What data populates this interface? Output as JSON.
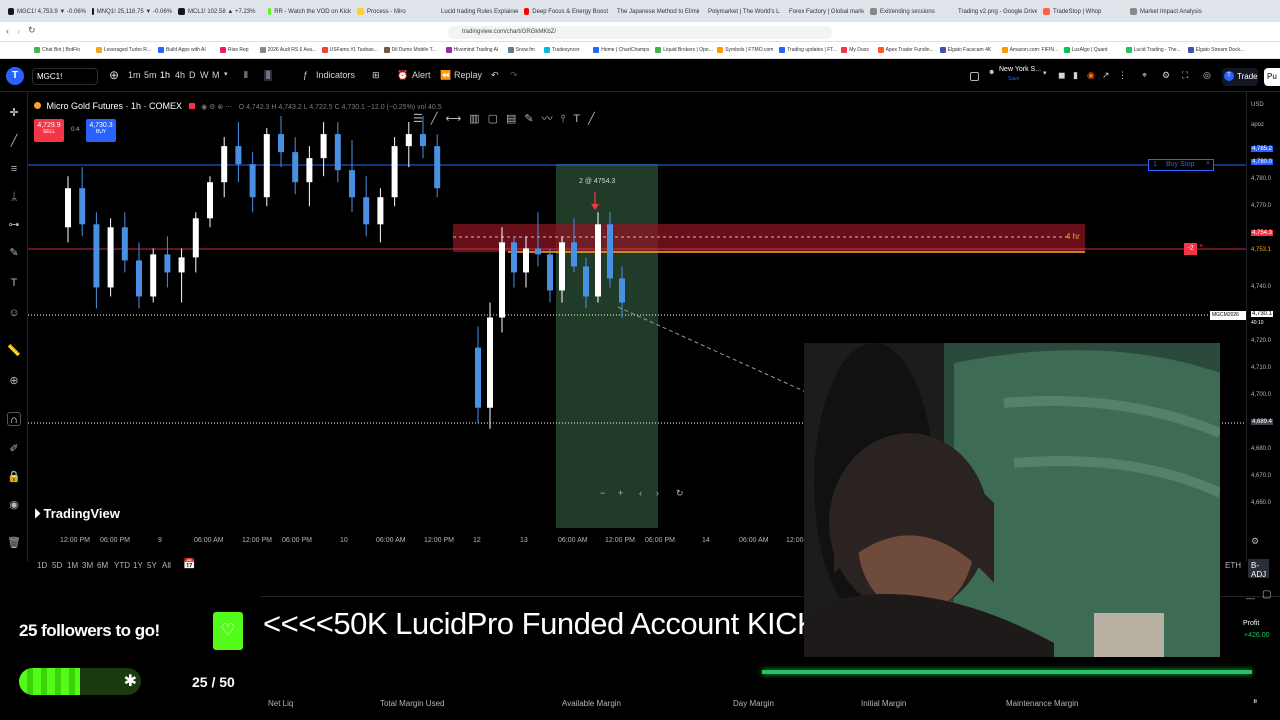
{
  "browser": {
    "tabs": [
      {
        "label": "MGC1! 4,753.9 ▼ -0.06%",
        "color": "#131722"
      },
      {
        "label": "MNQ1! 25,116.75 ▼ -0.06%",
        "color": "#131722"
      },
      {
        "label": "MCL1! 102.58 ▲ +7.23%",
        "color": "#131722"
      },
      {
        "label": "RR - Watch the VOD on Kick",
        "color": "#53fc18"
      },
      {
        "label": "Process - Miro",
        "color": "#ffd02f"
      },
      {
        "label": "Lucid trading Rules Explained",
        "color": "#4a90e2"
      },
      {
        "label": "Deep Focus & Energy Boost",
        "color": "#ff0000"
      },
      {
        "label": "The Japanese Method to Eliminate",
        "color": "#ff0000"
      },
      {
        "label": "Polymarket | The World's Largest",
        "color": "#2e5cff"
      },
      {
        "label": "Forex Factory | Global markets for",
        "color": "#2a66b0"
      },
      {
        "label": "Exit/ending sessions",
        "color": "#888888"
      },
      {
        "label": "Trading v2.png - Google Drive",
        "color": "#f4b400"
      },
      {
        "label": "TradeStop | Whop",
        "color": "#ff6243"
      },
      {
        "label": "Market Impact Analysis",
        "color": "#888888"
      }
    ],
    "url": "tradingview.com/chart/GRGkMKbZ/",
    "bookmarks": [
      "Chat Bot | BotFlo",
      "Leveraged Turbo R...",
      "Build Apps with AI",
      "Rise Rep",
      "2026 Audi RS 6 Ava...",
      "USFams #1 Taobao...",
      "Dil Dumo Mobile T...",
      "Hivemind Trading AI",
      "Snow.fm",
      "Tradesyncer",
      "Home | ChartChamps",
      "Liquid Brokers | Ope...",
      "Symbols | FTMO.com",
      "Trading updates | FT...",
      "My Duos",
      "Apex Trader Fundin...",
      "Elgato Facecam 4K",
      "Amazon.com: FIFIN...",
      "LuxAlgo | Quant",
      "Lucid Trading - The...",
      "Elgato Stream Deck..."
    ]
  },
  "toolbar": {
    "symbol": "MGC1!",
    "intervals": [
      "1m",
      "5m",
      "1h",
      "4h",
      "D",
      "W",
      "M"
    ],
    "indicators_label": "Indicators",
    "alert_label": "Alert",
    "replay_label": "Replay",
    "timezone": "New York S...",
    "timezone_sub": "Save",
    "trade_label": "Trade",
    "publish_label": "Pu"
  },
  "legend": {
    "title": "Micro Gold Futures · 1h · COMEX",
    "ohlc": "O 4,742.3  H 4,743.2  L 4,722.5  C 4,730.1  −12.0 (−0.25%)  vol 40.5",
    "sell_price": "4,729.9",
    "sell_label": "SELL",
    "spread": "0.4",
    "buy_price": "4,730.3",
    "buy_label": "BUY"
  },
  "annotations": {
    "order_label": "2 @ 4754.3",
    "zone_label": "4 hr",
    "buy_stop_qty": "1",
    "buy_stop_label": "Buy Stop",
    "position_qty": "-2",
    "symbol_tag": "MGCM2026",
    "symbol_tag_sub": "40:10"
  },
  "price_scale": {
    "currency": "USD",
    "mode": "apoz",
    "labels": [
      "4,785.2",
      "4,780.0",
      "4,770.0",
      "4,760.0",
      "4,754.3",
      "4,753.1",
      "4,740.0",
      "4,730.1",
      "4,720.0",
      "4,710.0",
      "4,700.0",
      "4,690.0",
      "4,689.4",
      "4,680.0",
      "4,670.0",
      "4,660.0"
    ]
  },
  "time_axis": [
    "12:00 PM",
    "06:00 PM",
    "9",
    "06:00 AM",
    "12:00 PM",
    "06:00 PM",
    "10",
    "06:00 AM",
    "12:00 PM",
    "12",
    "13",
    "06:00 AM",
    "12:00 PM",
    "06:00 PM",
    "14",
    "06:00 AM",
    "12:00"
  ],
  "ranges": [
    "1D",
    "5D",
    "1M",
    "3M",
    "6M",
    "YTD",
    "1Y",
    "5Y",
    "All"
  ],
  "bottom_right": {
    "eth": "ETH",
    "badj": "B-ADJ"
  },
  "branding": "TradingView",
  "chart_data": {
    "type": "candlestick",
    "candles": [
      [
        4755,
        4772,
        4750,
        4768
      ],
      [
        4768,
        4775,
        4752,
        4756
      ],
      [
        4756,
        4760,
        4728,
        4735
      ],
      [
        4735,
        4758,
        4732,
        4755
      ],
      [
        4755,
        4760,
        4740,
        4744
      ],
      [
        4744,
        4750,
        4728,
        4732
      ],
      [
        4732,
        4748,
        4730,
        4746
      ],
      [
        4746,
        4752,
        4735,
        4740
      ],
      [
        4740,
        4748,
        4730,
        4745
      ],
      [
        4745,
        4760,
        4740,
        4758
      ],
      [
        4758,
        4772,
        4755,
        4770
      ],
      [
        4770,
        4785,
        4765,
        4782
      ],
      [
        4782,
        4790,
        4770,
        4776
      ],
      [
        4776,
        4780,
        4760,
        4765
      ],
      [
        4765,
        4788,
        4762,
        4786
      ],
      [
        4786,
        4792,
        4775,
        4780
      ],
      [
        4780,
        4785,
        4766,
        4770
      ],
      [
        4770,
        4782,
        4762,
        4778
      ],
      [
        4778,
        4790,
        4772,
        4786
      ],
      [
        4786,
        4790,
        4770,
        4774
      ],
      [
        4774,
        4784,
        4760,
        4765
      ],
      [
        4765,
        4772,
        4752,
        4756
      ],
      [
        4756,
        4768,
        4750,
        4765
      ],
      [
        4765,
        4785,
        4762,
        4782
      ],
      [
        4782,
        4790,
        4775,
        4786
      ],
      [
        4786,
        4792,
        4778,
        4782
      ],
      [
        4782,
        4786,
        4765,
        4768
      ],
      [
        4715,
        4722,
        4690,
        4695
      ],
      [
        4695,
        4730,
        4688,
        4725
      ],
      [
        4725,
        4755,
        4720,
        4750
      ],
      [
        4750,
        4752,
        4735,
        4740
      ],
      [
        4740,
        4752,
        4735,
        4748
      ],
      [
        4748,
        4760,
        4742,
        4746
      ],
      [
        4746,
        4748,
        4730,
        4734
      ],
      [
        4734,
        4752,
        4730,
        4750
      ],
      [
        4750,
        4758,
        4740,
        4742
      ],
      [
        4742,
        4745,
        4728,
        4732
      ],
      [
        4732,
        4760,
        4730,
        4756
      ],
      [
        4756,
        4760,
        4735,
        4738
      ],
      [
        4738,
        4742,
        4725,
        4730
      ]
    ]
  }
}
